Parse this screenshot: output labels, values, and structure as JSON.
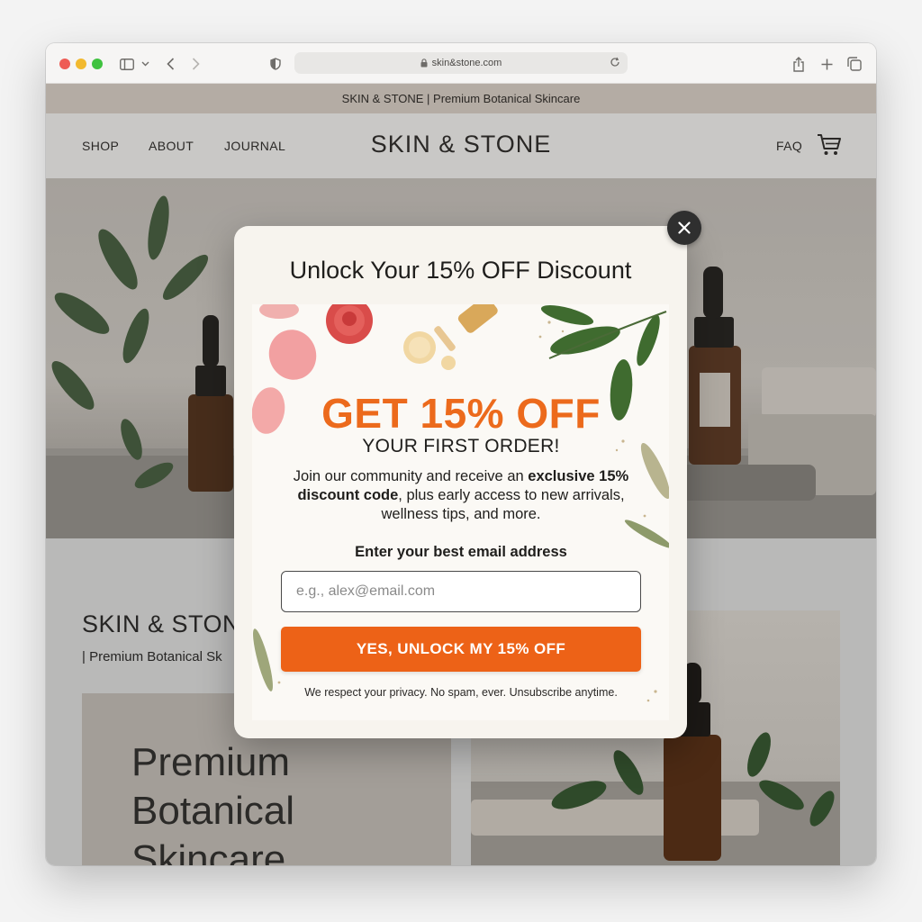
{
  "browser": {
    "url": "skin&stone.com"
  },
  "announcement": "SKIN & STONE | Premium Botanical Skincare",
  "nav": {
    "links": [
      "SHOP",
      "ABOUT",
      "JOURNAL"
    ],
    "logo": "SKIN & STONE",
    "faq": "FAQ"
  },
  "lower": {
    "title": "SKIN & STON",
    "subtitle": "| Premium Botanical Sk",
    "promo_text": "Premium\nBotanical\nSkincare"
  },
  "modal": {
    "title": "Unlock Your 15% OFF Discount",
    "headline": "GET 15% OFF",
    "subheadline": "YOUR FIRST ORDER!",
    "body_part1": "Join our community and receive an ",
    "body_bold1": "exclusive",
    "body_bold2": "15% discount code",
    "body_part2": ", plus early access to new arrivals, wellness tips, and more.",
    "email_label": "Enter your best email address",
    "email_placeholder": "e.g., alex@email.com",
    "email_value": "",
    "cta_label": "YES, UNLOCK MY 15% OFF",
    "privacy": "We respect your privacy. No spam, ever. Unsubscribe anytime."
  },
  "colors": {
    "accent": "#ed6217",
    "headline": "#ec6a1c",
    "announcement_bg": "#b4aca4",
    "nav_bg": "#c9c8c6"
  }
}
